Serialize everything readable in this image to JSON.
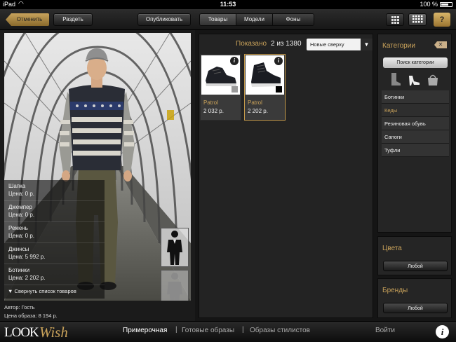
{
  "status_bar": {
    "carrier": "iPad",
    "time": "11:53",
    "battery": "100 %"
  },
  "left_toolbar": {
    "cancel": "Отменить",
    "undress": "Раздеть",
    "publish": "Опубликовать"
  },
  "outfit_items": [
    {
      "name": "Шапка",
      "price": "Цена: 0 р."
    },
    {
      "name": "Джемпер",
      "price": "Цена: 0 р."
    },
    {
      "name": "Ремень",
      "price": "Цена: 0 р."
    },
    {
      "name": "Джинсы",
      "price": "Цена: 5 992 р."
    },
    {
      "name": "Ботинки",
      "price": "Цена: 2 202 р."
    }
  ],
  "collapse_label": "Свернуть список товаров",
  "footer": {
    "author": "Автор: Гость",
    "outfit_price": "Цена образа: 8 194 р."
  },
  "tabs": [
    {
      "label": "Товары",
      "active": true
    },
    {
      "label": "Модели",
      "active": false
    },
    {
      "label": "Фоны",
      "active": false
    }
  ],
  "catalog": {
    "shown_label": "Показано",
    "shown_count": "2 из 1380",
    "sort_value": "Новые сверху",
    "products": [
      {
        "brand": "Patrol",
        "price": "2 032 р.",
        "swatch": "#9a9a9a",
        "selected": false
      },
      {
        "brand": "Patrol",
        "price": "2 202 р.",
        "swatch": "#000000",
        "selected": true
      }
    ]
  },
  "categories": {
    "title": "Категории",
    "search_button": "Поиск категории",
    "items": [
      {
        "label": "Ботинки",
        "active": false
      },
      {
        "label": "Кеды",
        "active": true
      },
      {
        "label": "Резиновая обувь",
        "active": false
      },
      {
        "label": "Сапоги",
        "active": false
      },
      {
        "label": "Туфли",
        "active": false
      }
    ]
  },
  "colors": {
    "title": "Цвета",
    "button": "Любой"
  },
  "brands": {
    "title": "Бренды",
    "button": "Любой"
  },
  "bottom_nav": {
    "logo_look": "LOOK",
    "logo_wish": "Wish",
    "fitting_room": "Примерочная",
    "ready_looks": "Готовые образы",
    "stylist_looks": "Образы стилистов",
    "login": "Войти",
    "separator": "|"
  },
  "accent_color": "#c9a25a"
}
